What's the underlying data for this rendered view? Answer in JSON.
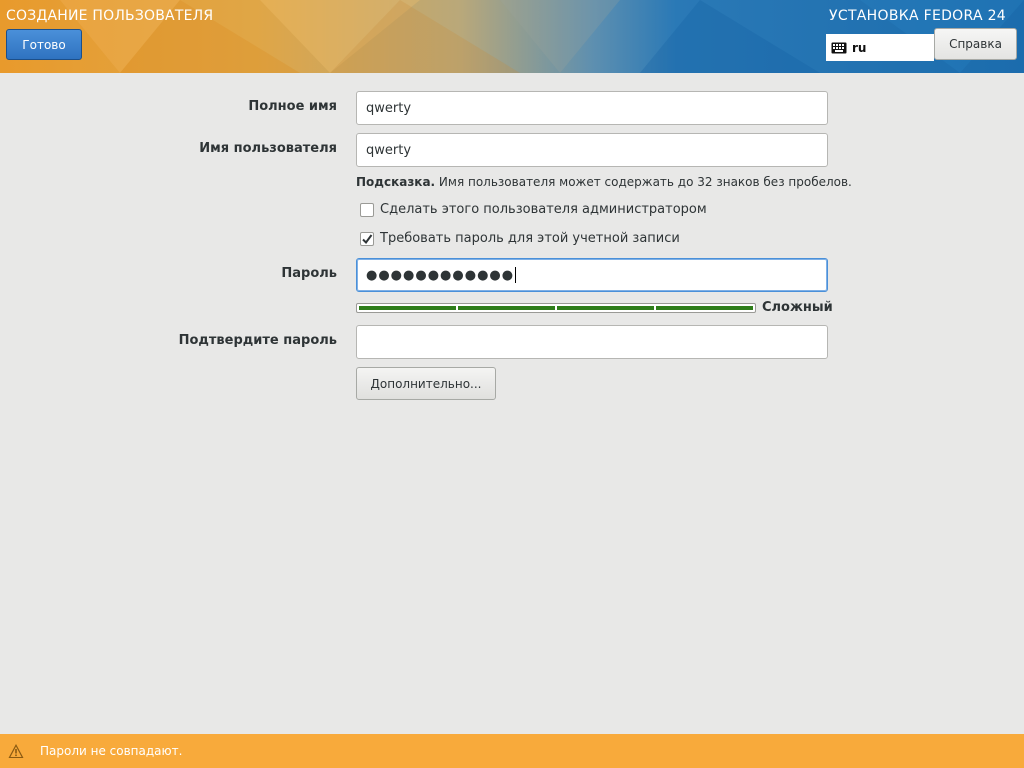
{
  "header": {
    "title": "СОЗДАНИЕ ПОЛЬЗОВАТЕЛЯ",
    "product": "УСТАНОВКА FEDORA 24",
    "done_label": "Готово",
    "keyboard_layout": "ru",
    "help_label": "Справка"
  },
  "form": {
    "fullname_label": "Полное имя",
    "fullname_value": "qwerty",
    "username_label": "Имя пользователя",
    "username_value": "qwerty",
    "hint_prefix": "Подсказка.",
    "hint_text": " Имя пользователя может содержать до 32 знаков без пробелов.",
    "admin_checkbox_label": "Сделать этого пользователя администратором",
    "admin_checked": false,
    "require_password_label": "Требовать пароль для этой учетной записи",
    "require_password_checked": true,
    "password_label": "Пароль",
    "password_value": "●●●●●●●●●●●●",
    "strength_label": "Сложный",
    "strength_level": 1.0,
    "confirm_label": "Подтвердите пароль",
    "confirm_value": "",
    "advanced_label": "Дополнительно..."
  },
  "warning": {
    "icon": "warning-icon",
    "text": "Пароли не совпадают."
  },
  "colors": {
    "done_button": "#3b7fce",
    "warning_bar": "#f8aa3b",
    "strength_fill": "#2e7d1a"
  }
}
